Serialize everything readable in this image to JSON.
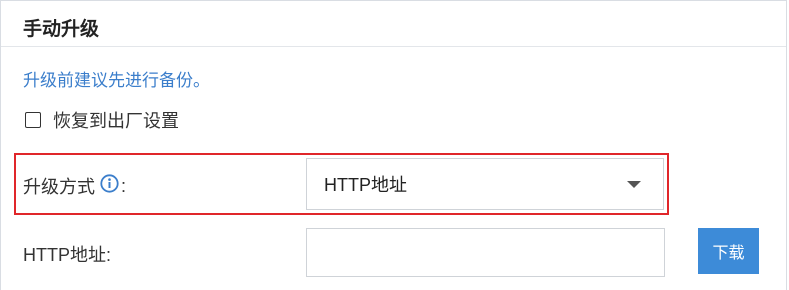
{
  "section": {
    "title": "手动升级",
    "hint": "升级前建议先进行备份。"
  },
  "restore_factory": {
    "label": "恢复到出厂设置",
    "checked": false
  },
  "upgrade_method": {
    "label": "升级方式",
    "colon": ":",
    "selected": "HTTP地址"
  },
  "http_address": {
    "label": "HTTP地址:",
    "value": "",
    "download_label": "下载"
  },
  "colors": {
    "accent": "#3d8bd8",
    "hint_text": "#3b7ecb",
    "highlight_border": "#e0262a"
  },
  "icons": {
    "info": "info-circle-icon",
    "caret": "chevron-down-icon"
  }
}
